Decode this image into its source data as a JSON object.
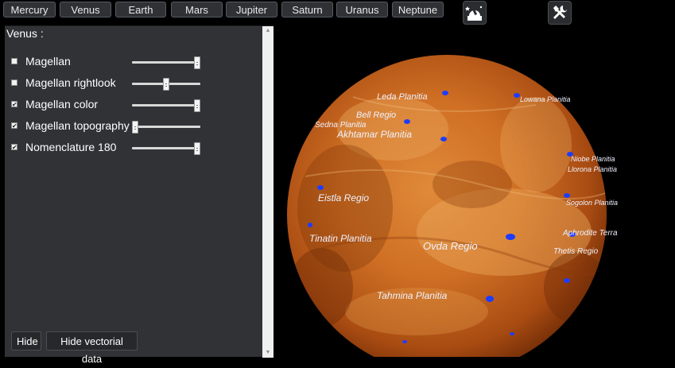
{
  "planet_bar": {
    "buttons": [
      {
        "label": "Mercury"
      },
      {
        "label": "Venus"
      },
      {
        "label": "Earth"
      },
      {
        "label": "Mars"
      },
      {
        "label": "Jupiter"
      },
      {
        "label": "Saturn"
      },
      {
        "label": "Uranus"
      },
      {
        "label": "Neptune"
      }
    ]
  },
  "toolbar": {
    "observatory_icon": "observatory-icon",
    "tools_icon": "tools-icon"
  },
  "panel": {
    "title": "Venus :",
    "layers": [
      {
        "label": "Magellan",
        "checked": false,
        "value": 1.0
      },
      {
        "label": "Magellan rightlook",
        "checked": false,
        "value": 0.5
      },
      {
        "label": "Magellan color",
        "checked": true,
        "value": 1.0
      },
      {
        "label": "Magellan topography",
        "checked": true,
        "value": 0.0
      },
      {
        "label": "Nomenclature 180",
        "checked": true,
        "value": 1.0
      }
    ],
    "hide_label": "Hide",
    "hide_vectorial_label": "Hide vectorial data"
  },
  "globe": {
    "features": [
      {
        "label": "Leda Planitia"
      },
      {
        "label": "Lowana Planitia"
      },
      {
        "label": "Bell Regio"
      },
      {
        "label": "Sedna Planitia"
      },
      {
        "label": "Akhtamar Planitia"
      },
      {
        "label": "Niobe Planitia"
      },
      {
        "label": "Llorona Planitia"
      },
      {
        "label": "Eistla Regio"
      },
      {
        "label": "Sogolon Planitia"
      },
      {
        "label": "Aphrodite Terra"
      },
      {
        "label": "Tinatin Planitia"
      },
      {
        "label": "Ovda Regio"
      },
      {
        "label": "Thetis Regio"
      },
      {
        "label": "Tahmina Planitia"
      }
    ]
  },
  "colors": {
    "background": "#000000",
    "panel": "#303236",
    "venus_surface": "#c86a22",
    "marker": "#1e3cff"
  }
}
